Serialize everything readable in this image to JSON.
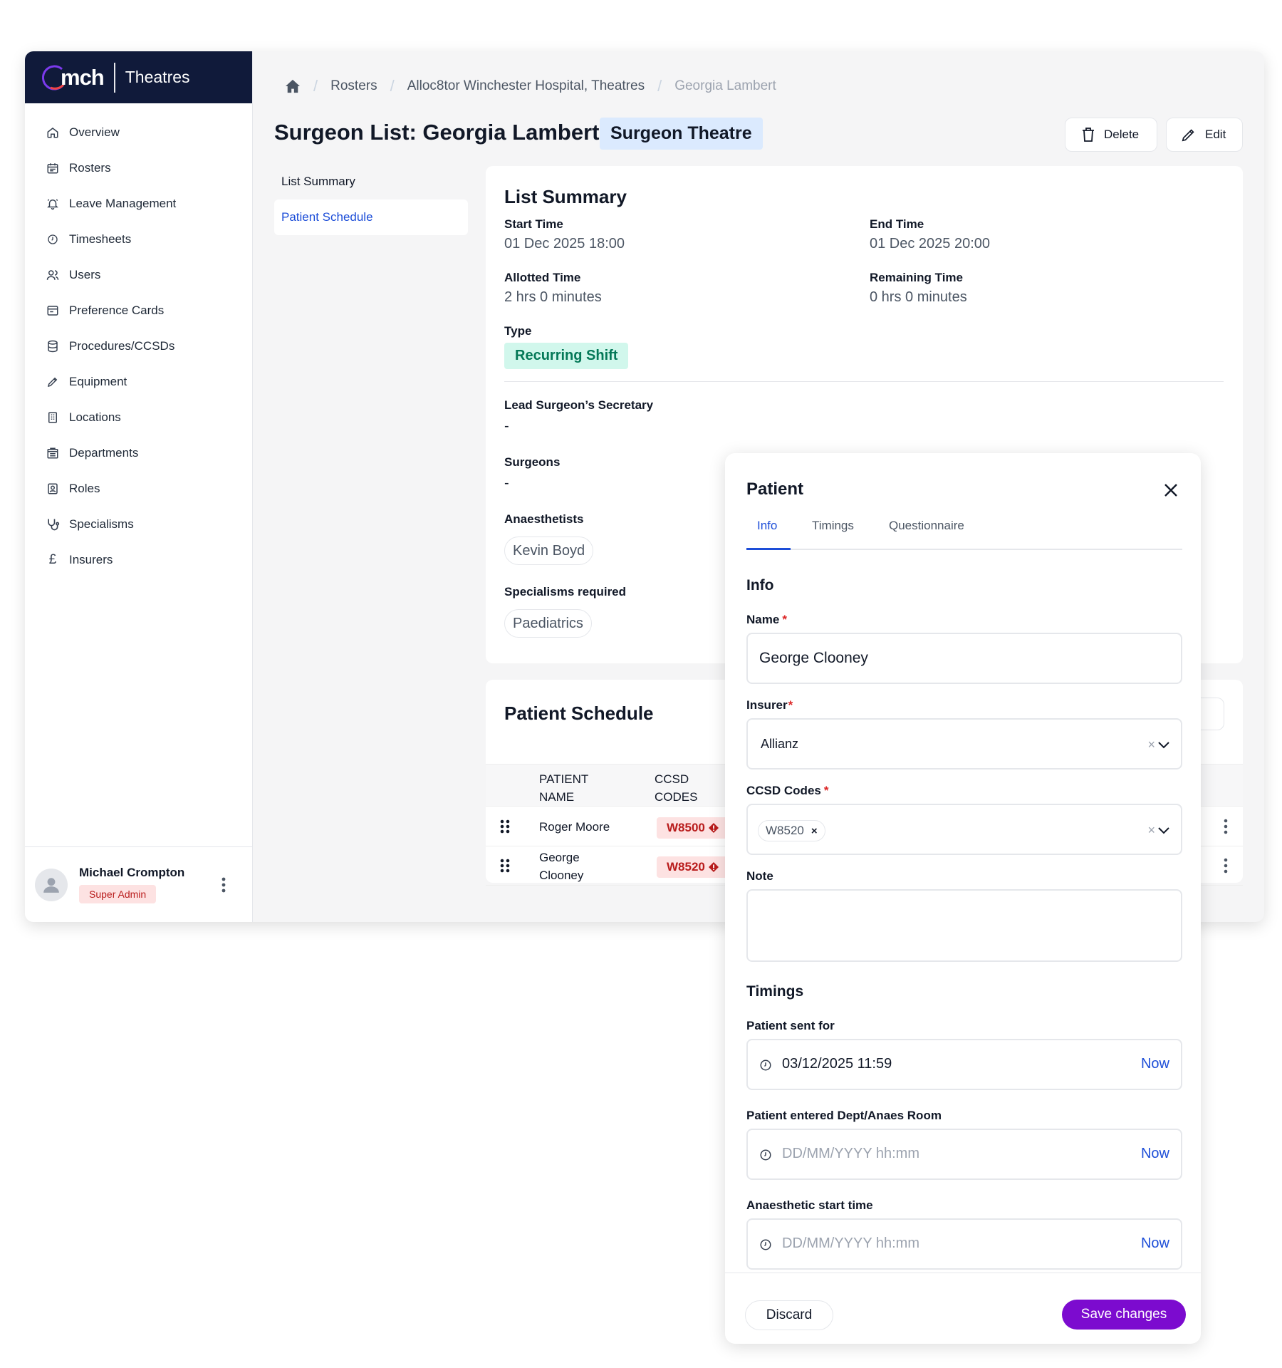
{
  "brand": {
    "logo_text": "mch",
    "product": "Theatres"
  },
  "sidebar": {
    "items": [
      {
        "label": "Overview",
        "icon": "home-icon"
      },
      {
        "label": "Rosters",
        "icon": "calendar-icon"
      },
      {
        "label": "Leave Management",
        "icon": "bell-icon"
      },
      {
        "label": "Timesheets",
        "icon": "clock-icon"
      },
      {
        "label": "Users",
        "icon": "users-icon"
      },
      {
        "label": "Preference Cards",
        "icon": "card-icon"
      },
      {
        "label": "Procedures/CCSDs",
        "icon": "database-icon"
      },
      {
        "label": "Equipment",
        "icon": "pen-icon"
      },
      {
        "label": "Locations",
        "icon": "building-icon"
      },
      {
        "label": "Departments",
        "icon": "office-icon"
      },
      {
        "label": "Roles",
        "icon": "badge-icon"
      },
      {
        "label": "Specialisms",
        "icon": "stethoscope-icon"
      },
      {
        "label": "Insurers",
        "icon": "pound-icon"
      }
    ],
    "user": {
      "name": "Michael Crompton",
      "role": "Super Admin"
    }
  },
  "breadcrumb": {
    "items": [
      "Rosters",
      "Alloc8tor Winchester Hospital, Theatres"
    ],
    "current": "Georgia Lambert"
  },
  "header": {
    "title": "Surgeon List: Georgia Lambert",
    "type_pill": "Surgeon Theatre",
    "delete_label": "Delete",
    "edit_label": "Edit"
  },
  "subnav": {
    "items": [
      "List Summary",
      "Patient Schedule"
    ],
    "active": "Patient Schedule"
  },
  "summary": {
    "title": "List Summary",
    "start_time_label": "Start Time",
    "start_time": "01 Dec 2025 18:00",
    "end_time_label": "End Time",
    "end_time": "01 Dec 2025 20:00",
    "allotted_label": "Allotted Time",
    "allotted": "2 hrs 0 minutes",
    "remaining_label": "Remaining Time",
    "remaining": "0 hrs 0 minutes",
    "type_label": "Type",
    "type": "Recurring Shift",
    "secretary_label": "Lead Surgeon’s Secretary",
    "secretary": "-",
    "surgeons_label": "Surgeons",
    "surgeons": "-",
    "anaesthetists_label": "Anaesthetists",
    "anaesthetists": [
      "Kevin Boyd"
    ],
    "specialisms_label": "Specialisms required",
    "specialisms": [
      "Paediatrics"
    ]
  },
  "schedule": {
    "title": "Patient Schedule",
    "columns": [
      "PATIENT NAME",
      "CCSD CODES"
    ],
    "rows": [
      {
        "name": "Roger Moore",
        "ccsd": "W8500"
      },
      {
        "name": "George Clooney",
        "ccsd": "W8520"
      }
    ]
  },
  "drawer": {
    "title": "Patient",
    "tabs": [
      "Info",
      "Timings",
      "Questionnaire"
    ],
    "active_tab": "Info",
    "info_title": "Info",
    "name_label": "Name",
    "name_value": "George Clooney",
    "insurer_label": "Insurer",
    "insurer_value": "Allianz",
    "ccsd_label": "CCSD Codes",
    "ccsd_tags": [
      "W8520"
    ],
    "note_label": "Note",
    "note_value": "",
    "timings_title": "Timings",
    "sent_for_label": "Patient sent for",
    "sent_for_value": "03/12/2025 11:59",
    "entered_label": "Patient entered Dept/Anaes Room",
    "entered_placeholder": "DD/MM/YYYY hh:mm",
    "anaes_label": "Anaesthetic start time",
    "anaes_placeholder": "DD/MM/YYYY hh:mm",
    "now_label": "Now",
    "discard_label": "Discard",
    "save_label": "Save changes"
  },
  "colors": {
    "brand_navy": "#101a3a",
    "accent_blue": "#1d4ed8",
    "save_purple": "#7c0bcf",
    "danger_red": "#b91c1c",
    "success_green": "#047857"
  }
}
